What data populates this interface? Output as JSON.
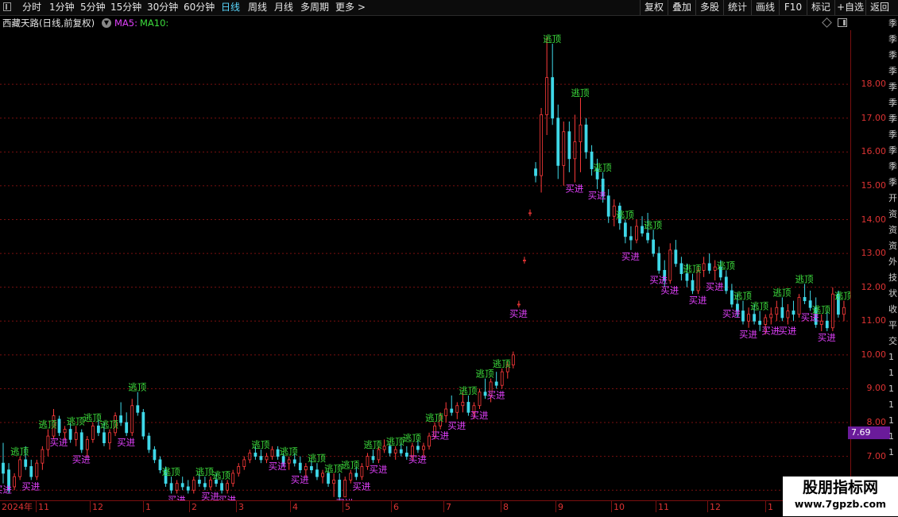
{
  "toolbar": {
    "periods": [
      "分时",
      "1分钟",
      "5分钟",
      "15分钟",
      "30分钟",
      "60分钟",
      "日线",
      "周线",
      "月线",
      "多周期",
      "更多 >"
    ],
    "active_period": "日线",
    "tools": [
      "复权",
      "叠加",
      "多股",
      "统计",
      "画线",
      "F10",
      "标记",
      "+自选",
      "返回"
    ]
  },
  "chart_header": {
    "stock_name": "西藏天路(日线,前复权)",
    "ma5_label": "MA5:",
    "ma10_label": "MA10:"
  },
  "colors": {
    "up": "#ff3b3b",
    "down": "#3fd8e8",
    "buy_signal": "#e040fb",
    "sell_signal": "#3cdc3c",
    "axis": "#dd3333",
    "grid": "#7a1010"
  },
  "right_strip_text": "季季季季季季季季季季季开资资资外技状收平交1111111",
  "chart_data": {
    "type": "candlestick",
    "y_ticks": [
      "18.00",
      "17.00",
      "16.00",
      "15.00",
      "14.00",
      "13.00",
      "12.00",
      "11.00",
      "10.00",
      "9.00",
      "8.00",
      "7.00",
      "6.00"
    ],
    "ylim": [
      5.7,
      19.6
    ],
    "last_price": "7.69",
    "x_labels": [
      "2024年",
      "11",
      "12",
      "1",
      "2",
      "3",
      "4",
      "5",
      "6",
      "7",
      "8",
      "9",
      "10",
      "11",
      "12",
      "1"
    ],
    "signals": {
      "buy": "买进",
      "sell": "逃顶"
    },
    "candles": [
      [
        6.8,
        7.4,
        6.2,
        6.5
      ],
      [
        6.6,
        6.8,
        5.9,
        6.0
      ],
      [
        6.1,
        6.5,
        6.0,
        6.4
      ],
      [
        6.4,
        7.0,
        6.3,
        6.9
      ],
      [
        6.9,
        7.3,
        6.6,
        6.7
      ],
      [
        6.7,
        6.9,
        6.3,
        6.4
      ],
      [
        6.4,
        6.9,
        6.3,
        6.8
      ],
      [
        6.8,
        7.3,
        6.6,
        7.2
      ],
      [
        7.2,
        7.8,
        7.0,
        7.6
      ],
      [
        7.6,
        8.4,
        7.5,
        8.2
      ],
      [
        8.1,
        8.2,
        7.6,
        7.7
      ],
      [
        7.7,
        7.9,
        7.5,
        7.8
      ],
      [
        7.8,
        8.0,
        7.4,
        7.5
      ],
      [
        7.5,
        7.9,
        7.3,
        7.7
      ],
      [
        7.7,
        7.8,
        7.1,
        7.2
      ],
      [
        7.2,
        7.6,
        7.0,
        7.5
      ],
      [
        7.5,
        8.0,
        7.4,
        7.9
      ],
      [
        7.9,
        8.1,
        7.6,
        7.7
      ],
      [
        7.7,
        8.0,
        7.3,
        7.4
      ],
      [
        7.4,
        7.8,
        7.2,
        7.7
      ],
      [
        7.7,
        8.3,
        7.6,
        8.2
      ],
      [
        8.2,
        8.6,
        7.9,
        8.0
      ],
      [
        8.0,
        8.3,
        7.6,
        7.7
      ],
      [
        7.7,
        8.7,
        7.6,
        8.5
      ],
      [
        8.5,
        8.9,
        8.2,
        8.3
      ],
      [
        8.3,
        8.4,
        7.5,
        7.6
      ],
      [
        7.6,
        7.7,
        7.1,
        7.2
      ],
      [
        7.2,
        7.3,
        6.8,
        6.9
      ],
      [
        6.9,
        7.0,
        6.5,
        6.6
      ],
      [
        6.6,
        6.7,
        6.1,
        6.2
      ],
      [
        6.2,
        6.4,
        5.9,
        6.0
      ],
      [
        6.0,
        6.3,
        5.9,
        6.2
      ],
      [
        6.2,
        6.4,
        6.0,
        6.1
      ],
      [
        6.1,
        6.3,
        5.9,
        6.0
      ],
      [
        6.0,
        6.4,
        5.9,
        6.3
      ],
      [
        6.3,
        6.5,
        6.1,
        6.2
      ],
      [
        6.2,
        6.4,
        6.0,
        6.1
      ],
      [
        6.1,
        6.4,
        6.0,
        6.3
      ],
      [
        6.3,
        6.5,
        6.1,
        6.2
      ],
      [
        6.2,
        6.3,
        5.9,
        6.0
      ],
      [
        6.0,
        6.3,
        5.9,
        6.2
      ],
      [
        6.2,
        6.6,
        6.1,
        6.5
      ],
      [
        6.5,
        6.8,
        6.4,
        6.7
      ],
      [
        6.7,
        7.0,
        6.6,
        6.9
      ],
      [
        6.9,
        7.2,
        6.8,
        7.1
      ],
      [
        7.1,
        7.3,
        6.9,
        7.0
      ],
      [
        7.0,
        7.2,
        6.8,
        6.9
      ],
      [
        6.9,
        7.1,
        6.8,
        7.0
      ],
      [
        7.0,
        7.3,
        6.9,
        7.2
      ],
      [
        7.2,
        7.3,
        6.9,
        7.0
      ],
      [
        7.0,
        7.1,
        6.7,
        6.8
      ],
      [
        6.8,
        7.0,
        6.6,
        6.9
      ],
      [
        6.9,
        7.1,
        6.7,
        6.8
      ],
      [
        6.8,
        7.0,
        6.5,
        6.6
      ],
      [
        6.6,
        6.8,
        6.4,
        6.7
      ],
      [
        6.7,
        6.9,
        6.5,
        6.6
      ],
      [
        6.6,
        6.8,
        6.3,
        6.4
      ],
      [
        6.4,
        6.6,
        6.2,
        6.5
      ],
      [
        6.5,
        6.6,
        6.1,
        6.2
      ],
      [
        6.2,
        6.5,
        5.8,
        6.3
      ],
      [
        6.3,
        6.5,
        5.7,
        5.8
      ],
      [
        5.8,
        6.4,
        5.8,
        6.3
      ],
      [
        6.3,
        6.6,
        6.2,
        6.5
      ],
      [
        6.5,
        6.7,
        6.3,
        6.4
      ],
      [
        6.4,
        6.8,
        6.3,
        6.7
      ],
      [
        6.7,
        7.1,
        6.6,
        7.0
      ],
      [
        7.0,
        7.2,
        6.8,
        6.9
      ],
      [
        6.9,
        7.3,
        6.8,
        7.2
      ],
      [
        7.2,
        7.5,
        7.1,
        7.3
      ],
      [
        7.3,
        7.4,
        7.0,
        7.1
      ],
      [
        7.1,
        7.3,
        6.9,
        7.2
      ],
      [
        7.2,
        7.4,
        7.0,
        7.1
      ],
      [
        7.1,
        7.3,
        6.9,
        7.0
      ],
      [
        7.0,
        7.4,
        6.9,
        7.3
      ],
      [
        7.3,
        7.5,
        7.1,
        7.2
      ],
      [
        7.2,
        7.4,
        7.0,
        7.3
      ],
      [
        7.3,
        7.7,
        7.2,
        7.6
      ],
      [
        7.6,
        8.0,
        7.5,
        7.9
      ],
      [
        7.9,
        8.3,
        7.8,
        8.2
      ],
      [
        8.2,
        8.6,
        8.0,
        8.4
      ],
      [
        8.4,
        8.8,
        8.2,
        8.3
      ],
      [
        8.3,
        8.6,
        8.1,
        8.5
      ],
      [
        8.5,
        8.9,
        8.3,
        8.6
      ],
      [
        8.6,
        8.8,
        8.2,
        8.3
      ],
      [
        8.3,
        8.6,
        8.1,
        8.5
      ],
      [
        8.5,
        9.0,
        8.4,
        8.9
      ],
      [
        8.9,
        9.3,
        8.7,
        8.8
      ],
      [
        8.8,
        9.3,
        8.6,
        9.2
      ],
      [
        9.2,
        9.5,
        9.0,
        9.1
      ],
      [
        9.1,
        9.6,
        9.0,
        9.5
      ],
      [
        9.5,
        9.8,
        9.3,
        9.7
      ],
      [
        9.7,
        10.1,
        9.6,
        10.0
      ],
      [
        11.5,
        11.6,
        11.4,
        11.5
      ],
      [
        12.8,
        12.9,
        12.7,
        12.8
      ],
      [
        14.2,
        14.3,
        14.1,
        14.2
      ],
      [
        15.5,
        15.7,
        15.1,
        15.3
      ],
      [
        15.3,
        17.3,
        14.8,
        17.1
      ],
      [
        17.1,
        19.4,
        16.5,
        18.2
      ],
      [
        18.2,
        19.2,
        16.8,
        17.0
      ],
      [
        17.0,
        17.4,
        15.2,
        15.6
      ],
      [
        15.6,
        16.9,
        15.0,
        16.6
      ],
      [
        16.6,
        16.9,
        15.4,
        15.8
      ],
      [
        15.8,
        17.1,
        15.1,
        16.3
      ],
      [
        16.3,
        17.6,
        15.4,
        16.8
      ],
      [
        16.8,
        17.0,
        15.8,
        16.0
      ],
      [
        16.0,
        16.2,
        15.3,
        15.5
      ],
      [
        15.5,
        15.8,
        14.9,
        15.2
      ],
      [
        15.2,
        15.4,
        14.5,
        14.7
      ],
      [
        14.7,
        14.9,
        13.9,
        14.1
      ],
      [
        14.1,
        14.6,
        13.8,
        14.4
      ],
      [
        14.4,
        14.5,
        13.7,
        13.9
      ],
      [
        13.9,
        14.0,
        13.3,
        13.5
      ],
      [
        13.5,
        13.8,
        13.1,
        13.4
      ],
      [
        13.4,
        14.0,
        13.3,
        13.8
      ],
      [
        13.8,
        14.1,
        13.5,
        13.6
      ],
      [
        13.6,
        14.2,
        13.3,
        13.4
      ],
      [
        13.4,
        13.7,
        12.9,
        13.0
      ],
      [
        13.0,
        13.2,
        12.4,
        12.5
      ],
      [
        12.5,
        12.8,
        12.0,
        12.2
      ],
      [
        12.2,
        13.3,
        12.1,
        13.1
      ],
      [
        13.1,
        13.4,
        12.6,
        12.7
      ],
      [
        12.7,
        12.9,
        12.2,
        12.4
      ],
      [
        12.4,
        12.7,
        12.0,
        12.2
      ],
      [
        12.2,
        12.4,
        11.8,
        11.9
      ],
      [
        11.9,
        12.6,
        11.8,
        12.5
      ],
      [
        12.5,
        12.9,
        12.3,
        12.7
      ],
      [
        12.7,
        13.0,
        12.4,
        12.5
      ],
      [
        12.5,
        12.8,
        12.2,
        12.6
      ],
      [
        12.6,
        12.8,
        12.2,
        12.3
      ],
      [
        12.3,
        12.5,
        11.8,
        11.9
      ],
      [
        11.9,
        12.1,
        11.4,
        11.5
      ],
      [
        11.5,
        11.8,
        11.1,
        11.3
      ],
      [
        11.3,
        11.6,
        10.9,
        11.0
      ],
      [
        11.0,
        11.4,
        10.8,
        11.2
      ],
      [
        11.2,
        11.5,
        10.9,
        11.0
      ],
      [
        11.0,
        11.3,
        10.7,
        10.9
      ],
      [
        10.9,
        11.2,
        10.6,
        11.1
      ],
      [
        11.1,
        11.4,
        10.9,
        11.2
      ],
      [
        11.2,
        11.6,
        11.0,
        11.4
      ],
      [
        11.4,
        11.7,
        11.0,
        11.1
      ],
      [
        11.1,
        11.5,
        10.9,
        11.3
      ],
      [
        11.3,
        11.6,
        11.0,
        11.2
      ],
      [
        11.2,
        11.8,
        11.1,
        11.7
      ],
      [
        11.7,
        12.1,
        11.5,
        11.6
      ],
      [
        11.6,
        11.9,
        11.3,
        11.4
      ],
      [
        11.4,
        11.7,
        10.8,
        10.9
      ],
      [
        10.9,
        11.2,
        10.7,
        11.0
      ],
      [
        11.0,
        11.3,
        10.7,
        10.8
      ],
      [
        10.8,
        12.0,
        10.7,
        11.8
      ],
      [
        11.8,
        11.9,
        11.1,
        11.2
      ],
      [
        11.2,
        11.6,
        11.0,
        11.4
      ]
    ],
    "signal_points": [
      {
        "i": 0,
        "t": "buy"
      },
      {
        "i": 3,
        "t": "sell"
      },
      {
        "i": 5,
        "t": "buy"
      },
      {
        "i": 8,
        "t": "sell"
      },
      {
        "i": 10,
        "t": "buy"
      },
      {
        "i": 13,
        "t": "sell"
      },
      {
        "i": 14,
        "t": "buy"
      },
      {
        "i": 16,
        "t": "sell"
      },
      {
        "i": 19,
        "t": "sell"
      },
      {
        "i": 22,
        "t": "buy"
      },
      {
        "i": 24,
        "t": "sell"
      },
      {
        "i": 30,
        "t": "sell"
      },
      {
        "i": 31,
        "t": "buy"
      },
      {
        "i": 36,
        "t": "sell"
      },
      {
        "i": 37,
        "t": "buy"
      },
      {
        "i": 39,
        "t": "sell"
      },
      {
        "i": 40,
        "t": "buy"
      },
      {
        "i": 46,
        "t": "sell"
      },
      {
        "i": 49,
        "t": "buy"
      },
      {
        "i": 51,
        "t": "sell"
      },
      {
        "i": 53,
        "t": "buy"
      },
      {
        "i": 56,
        "t": "sell"
      },
      {
        "i": 59,
        "t": "sell"
      },
      {
        "i": 61,
        "t": "buy"
      },
      {
        "i": 62,
        "t": "sell"
      },
      {
        "i": 64,
        "t": "buy"
      },
      {
        "i": 66,
        "t": "sell"
      },
      {
        "i": 67,
        "t": "buy"
      },
      {
        "i": 70,
        "t": "sell"
      },
      {
        "i": 73,
        "t": "sell"
      },
      {
        "i": 74,
        "t": "buy"
      },
      {
        "i": 77,
        "t": "sell"
      },
      {
        "i": 78,
        "t": "buy"
      },
      {
        "i": 81,
        "t": "buy"
      },
      {
        "i": 83,
        "t": "sell"
      },
      {
        "i": 85,
        "t": "buy"
      },
      {
        "i": 86,
        "t": "sell"
      },
      {
        "i": 88,
        "t": "buy"
      },
      {
        "i": 89,
        "t": "sell"
      },
      {
        "i": 92,
        "t": "buy"
      },
      {
        "i": 98,
        "t": "sell"
      },
      {
        "i": 102,
        "t": "buy"
      },
      {
        "i": 103,
        "t": "sell"
      },
      {
        "i": 106,
        "t": "buy"
      },
      {
        "i": 107,
        "t": "sell"
      },
      {
        "i": 111,
        "t": "sell"
      },
      {
        "i": 112,
        "t": "buy"
      },
      {
        "i": 116,
        "t": "sell"
      },
      {
        "i": 117,
        "t": "buy"
      },
      {
        "i": 119,
        "t": "buy"
      },
      {
        "i": 123,
        "t": "sell"
      },
      {
        "i": 124,
        "t": "buy"
      },
      {
        "i": 127,
        "t": "buy"
      },
      {
        "i": 129,
        "t": "sell"
      },
      {
        "i": 130,
        "t": "buy"
      },
      {
        "i": 132,
        "t": "sell"
      },
      {
        "i": 133,
        "t": "buy"
      },
      {
        "i": 135,
        "t": "sell"
      },
      {
        "i": 137,
        "t": "buy"
      },
      {
        "i": 139,
        "t": "sell"
      },
      {
        "i": 140,
        "t": "buy"
      },
      {
        "i": 143,
        "t": "sell"
      },
      {
        "i": 144,
        "t": "buy"
      },
      {
        "i": 146,
        "t": "sell"
      },
      {
        "i": 147,
        "t": "buy"
      },
      {
        "i": 150,
        "t": "sell"
      },
      {
        "i": 151,
        "t": "buy"
      },
      {
        "i": 153,
        "t": "buy"
      },
      {
        "i": 154,
        "t": "sell"
      },
      {
        "i": 156,
        "t": "sell"
      },
      {
        "i": 157,
        "t": "buy"
      },
      {
        "i": 159,
        "t": "sell"
      },
      {
        "i": 160,
        "t": "buy"
      },
      {
        "i": 163,
        "t": "sell"
      },
      {
        "i": 164,
        "t": "buy"
      }
    ]
  },
  "watermark": {
    "title": "股朋指标网",
    "url": "www.7gpzb.com"
  }
}
